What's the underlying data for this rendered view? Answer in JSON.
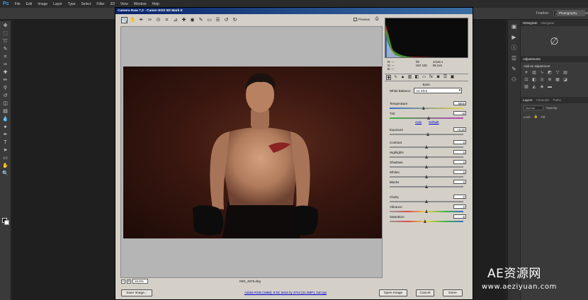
{
  "photoshop": {
    "logo": "Ps",
    "menu": [
      "File",
      "Edit",
      "Image",
      "Layer",
      "Type",
      "Select",
      "Filter",
      "3D",
      "View",
      "Window",
      "Help"
    ],
    "options": {
      "feather_label": "Feather:",
      "feather_value": "0 px",
      "antialias_label": "Anti-alias"
    },
    "workspace": "Photography",
    "panels": {
      "tabs_top": [
        "Histogram",
        "Navigator"
      ],
      "tabs_adjust": [
        "Adjustments"
      ],
      "adjust_title": "Add an adjustment",
      "tabs_layers": [
        "Layers",
        "Channels",
        "Paths"
      ],
      "layers_kind": "Normal",
      "layers_opacity_label": "Opacity:",
      "layers_lock_label": "Lock:",
      "layers_fill_label": "Fill:"
    }
  },
  "camera_raw": {
    "title": "Camera Raw 7.2  -  Canon EOS 5D Mark II",
    "preview_label": "Preview",
    "preview_checked": "✓",
    "zoom_value": "16.9%",
    "filename": "IMG_4675.dng",
    "workflow_link": "Adobe RGB (1998); 8 bit; 5616 by 3744 (21.0MP); 240 ppi",
    "buttons": {
      "save": "Save Image...",
      "open": "Open Image",
      "cancel": "Cancel",
      "done": "Done"
    },
    "readout": {
      "r": "R:  ---",
      "g": "G:  ---",
      "b": "B:  ---",
      "aperture": "f/9",
      "shutter": "1/125 s",
      "iso": "ISO 100",
      "focal": "85 mm"
    },
    "panel_name": "Basic",
    "white_balance_label": "White Balance:",
    "white_balance_value": "As Shot",
    "auto_label": "Auto",
    "default_label": "Default",
    "sliders": [
      {
        "label": "Temperature",
        "value": "5600",
        "pos": 0.46,
        "gradient": "linear-gradient(90deg,#3a6cc8,#e8d24a)"
      },
      {
        "label": "Tint",
        "value": "+8",
        "pos": 0.53,
        "gradient": "linear-gradient(90deg,#3fb23f,#c23fc2)"
      },
      {
        "label": "Exposure",
        "value": "+0.20",
        "pos": 0.52,
        "gradient": ""
      },
      {
        "label": "Contrast",
        "value": "0",
        "pos": 0.5,
        "gradient": ""
      },
      {
        "label": "Highlights",
        "value": "0",
        "pos": 0.5,
        "gradient": ""
      },
      {
        "label": "Shadows",
        "value": "0",
        "pos": 0.5,
        "gradient": ""
      },
      {
        "label": "Whites",
        "value": "0",
        "pos": 0.5,
        "gradient": ""
      },
      {
        "label": "Blacks",
        "value": "0",
        "pos": 0.5,
        "gradient": ""
      },
      {
        "label": "Clarity",
        "value": "0",
        "pos": 0.5,
        "gradient": ""
      },
      {
        "label": "Vibrance",
        "value": "0",
        "pos": 0.5,
        "gradient": "linear-gradient(90deg,#9a9a9a,#d94a4a,#e8d24a,#3fb23f,#3a6cc8)"
      },
      {
        "label": "Saturation",
        "value": "-6",
        "pos": 0.48,
        "gradient": "linear-gradient(90deg,#9a9a9a,#d94a4a,#e8d24a,#3fb23f,#3a6cc8)"
      }
    ]
  },
  "watermark": {
    "title": "AE资源网",
    "url": "www.aeziyuan.com"
  }
}
